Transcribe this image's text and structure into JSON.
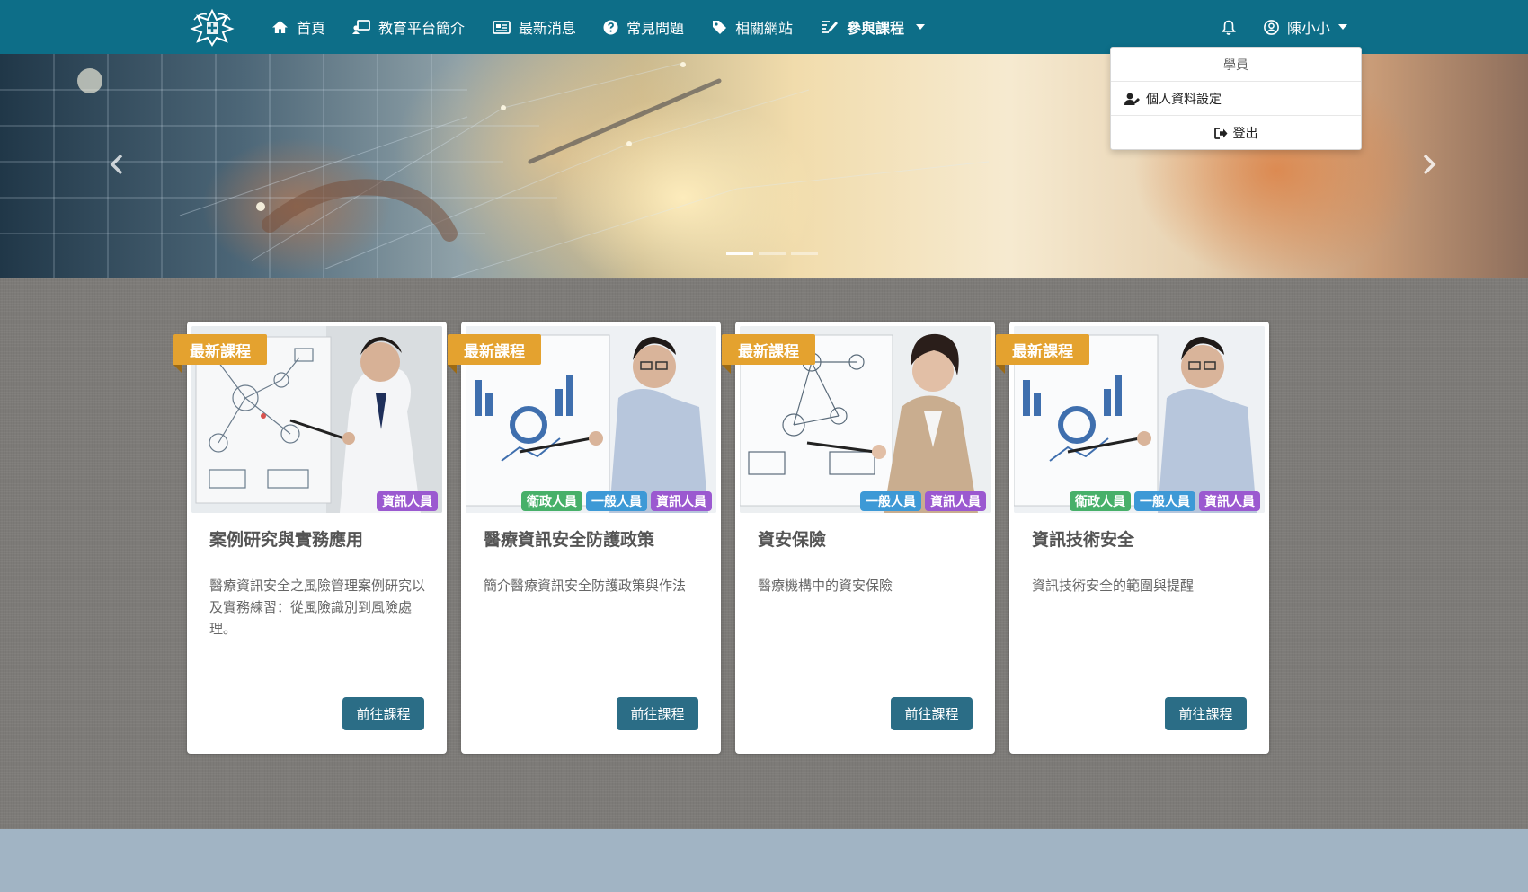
{
  "nav": {
    "items": [
      {
        "label": "首頁",
        "icon": "home-icon"
      },
      {
        "label": "教育平台簡介",
        "icon": "chalkboard-teacher-icon"
      },
      {
        "label": "最新消息",
        "icon": "newspaper-icon"
      },
      {
        "label": "常見問題",
        "icon": "question-circle-icon"
      },
      {
        "label": "相關網站",
        "icon": "tag-icon"
      },
      {
        "label": "參與課程",
        "icon": "edit-icon"
      }
    ],
    "user_name": "陳小小"
  },
  "dropdown": {
    "header": "學員",
    "profile_label": "個人資料設定",
    "logout_label": "登出"
  },
  "carousel": {
    "slide_count": 3,
    "active_index": 0
  },
  "courses": [
    {
      "badge": "最新課程",
      "title": "案例研究與實務應用",
      "description": "醫療資訊安全之風險管理案例研究以及實務練習：從風險識別到風險處理。",
      "tags": [
        "資訊人員"
      ],
      "button": "前往課程"
    },
    {
      "badge": "最新課程",
      "title": "醫療資訊安全防護政策",
      "description": "簡介醫療資訊安全防護政策與作法",
      "tags": [
        "衛政人員",
        "一般人員",
        "資訊人員"
      ],
      "button": "前往課程"
    },
    {
      "badge": "最新課程",
      "title": "資安保險",
      "description": "醫療機構中的資安保險",
      "tags": [
        "一般人員",
        "資訊人員"
      ],
      "button": "前往課程"
    },
    {
      "badge": "最新課程",
      "title": "資訊技術安全",
      "description": "資訊技術安全的範圍與提醒",
      "tags": [
        "衛政人員",
        "一般人員",
        "資訊人員"
      ],
      "button": "前往課程"
    }
  ],
  "colors": {
    "navbar": "#0d6e88",
    "badge": "#e4a22f",
    "button": "#2b6d86",
    "tag_green": "#47b069",
    "tag_blue": "#3d99d6",
    "tag_purple": "#9b59d0",
    "main_bg": "#7d7b78",
    "footer_bg": "#a1b4c4"
  }
}
